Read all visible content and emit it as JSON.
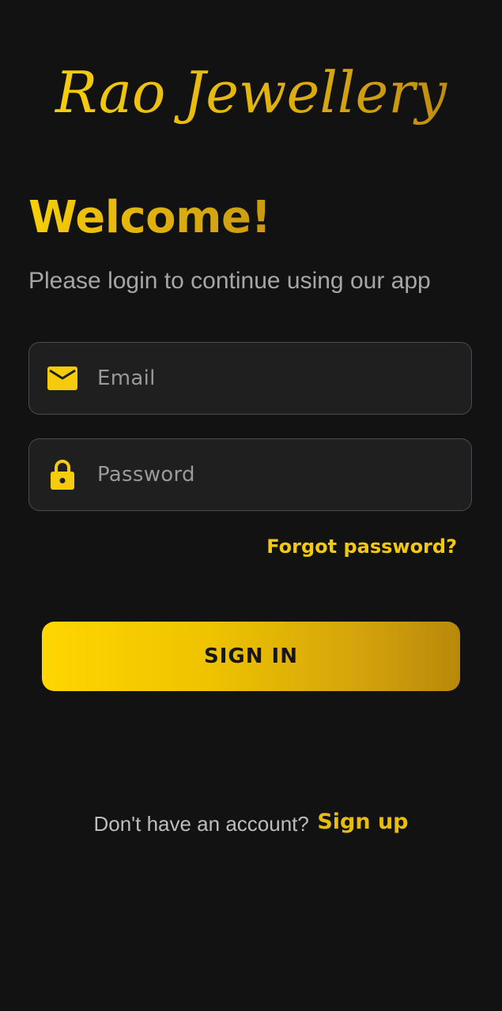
{
  "app": {
    "brand_name": "Rao Jewellery"
  },
  "login": {
    "title": "Welcome!",
    "subtitle": "Please login to continue using our app",
    "email": {
      "placeholder": "Email",
      "value": "",
      "icon": "mail-icon"
    },
    "password": {
      "placeholder": "Password",
      "value": "",
      "icon": "lock-icon"
    },
    "forgot_password_label": "Forgot password?",
    "sign_in_label": "SIGN IN",
    "signup_prompt": "Don't have an account?",
    "signup_label": "Sign up"
  },
  "colors": {
    "background": "#121212",
    "field_background": "#1f1f1f",
    "field_border": "#4b4b53",
    "accent_gold": "#f2c90f",
    "accent_gold_dark": "#b8880b",
    "muted_text": "#a6a6a6"
  }
}
